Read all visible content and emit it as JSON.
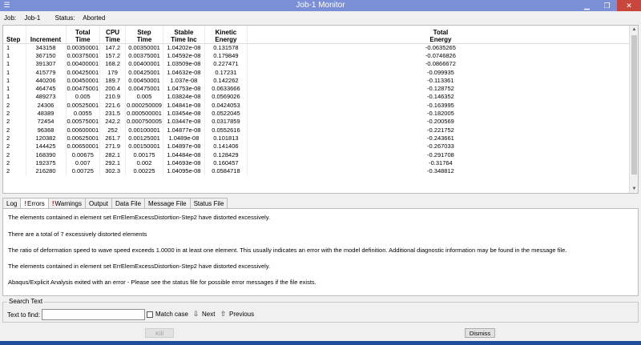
{
  "window": {
    "title": "Job-1 Monitor",
    "system_icon": "app-menu-icon",
    "controls": {
      "minimize": "▁",
      "maximize": "❐",
      "close": "✕"
    }
  },
  "status": {
    "job_label": "Job:",
    "job_value": "Job-1",
    "status_label": "Status:",
    "status_value": "Aborted"
  },
  "table": {
    "columns": [
      "Step",
      "Increment",
      "Total\nTime",
      "CPU\nTime",
      "Step\nTime",
      "Stable\nTime Inc",
      "Kinetic\nEnergy",
      "Total\nEnergy"
    ],
    "rows": [
      [
        "1",
        "343158",
        "0.00350001",
        "147.2",
        "0.00350001",
        "1.04202e-08",
        "0.131578",
        "-0.0635265"
      ],
      [
        "1",
        "367150",
        "0.00375001",
        "157.2",
        "0.00375001",
        "1.04592e-08",
        "0.179849",
        "-0.0746826"
      ],
      [
        "1",
        "391307",
        "0.00400001",
        "168.2",
        "0.00400001",
        "1.03509e-08",
        "0.227471",
        "-0.0866672"
      ],
      [
        "1",
        "415779",
        "0.00425001",
        "179",
        "0.00425001",
        "1.04632e-08",
        "0.17231",
        "-0.099935"
      ],
      [
        "1",
        "440206",
        "0.00450001",
        "189.7",
        "0.00450001",
        "1.037e-08",
        "0.142262",
        "-0.113361"
      ],
      [
        "1",
        "464745",
        "0.00475001",
        "200.4",
        "0.00475001",
        "1.04753e-08",
        "0.0633666",
        "-0.128752"
      ],
      [
        "1",
        "489273",
        "0.005",
        "210.9",
        "0.005",
        "1.03824e-08",
        "0.0569026",
        "-0.146352"
      ],
      [
        "2",
        "24306",
        "0.00525001",
        "221.6",
        "0.000250009",
        "1.04841e-08",
        "0.0424053",
        "-0.163995"
      ],
      [
        "2",
        "48389",
        "0.0055",
        "231.5",
        "0.000500001",
        "1.03454e-08",
        "0.0522045",
        "-0.182005"
      ],
      [
        "2",
        "72454",
        "0.00575001",
        "242.2",
        "0.000750005",
        "1.03447e-08",
        "0.0317859",
        "-0.200569"
      ],
      [
        "2",
        "96368",
        "0.00600001",
        "252",
        "0.00100001",
        "1.04877e-08",
        "0.0552616",
        "-0.221752"
      ],
      [
        "2",
        "120382",
        "0.00625001",
        "261.7",
        "0.00125001",
        "1.0489e-08",
        "0.101813",
        "-0.243661"
      ],
      [
        "2",
        "144425",
        "0.00650001",
        "271.9",
        "0.00150001",
        "1.04897e-08",
        "0.141406",
        "-0.267033"
      ],
      [
        "2",
        "168390",
        "0.00675",
        "282.1",
        "0.00175",
        "1.04484e-08",
        "0.128429",
        "-0.291708"
      ],
      [
        "2",
        "192375",
        "0.007",
        "292.1",
        "0.002",
        "1.04693e-08",
        "0.160457",
        "-0.31764"
      ],
      [
        "2",
        "216280",
        "0.00725",
        "302.3",
        "0.00225",
        "1.04095e-08",
        "0.0584718",
        "-0.348812"
      ]
    ]
  },
  "tabs": [
    {
      "label": "Log",
      "error": false,
      "active": false
    },
    {
      "label": "Errors",
      "error": true,
      "active": true
    },
    {
      "label": "Warnings",
      "error": true,
      "active": false
    },
    {
      "label": "Output",
      "error": false,
      "active": false
    },
    {
      "label": "Data File",
      "error": false,
      "active": false
    },
    {
      "label": "Message File",
      "error": false,
      "active": false
    },
    {
      "label": "Status File",
      "error": false,
      "active": false
    }
  ],
  "messages": [
    "The elements contained in element set ErrElemExcessDistortion-Step2 have distorted excessively.",
    "There are a total of 7 excessively distorted elements",
    "The ratio of deformation speed to wave speed exceeds 1.0000 in at least one element. This usually indicates an error with the model definition. Additional diagnostic information may be found in the message file.",
    "The elements contained in element set ErrElemExcessDistortion-Step2 have distorted excessively.",
    "Abaqus/Explicit Analysis exited with an error - Please see the  status file for possible error messages if the file exists."
  ],
  "search": {
    "group_label": "Search Text",
    "find_label": "Text to find:",
    "find_value": "",
    "match_case_label": "Match case",
    "match_case_checked": false,
    "next_label": "Next",
    "previous_label": "Previous"
  },
  "buttons": {
    "kill": "Kill",
    "dismiss": "Dismiss"
  },
  "colors": {
    "titlebar": "#7a8fd6",
    "close_button": "#c9463d",
    "error_mark": "#d40000",
    "taskbar": "#1f4e9a"
  }
}
